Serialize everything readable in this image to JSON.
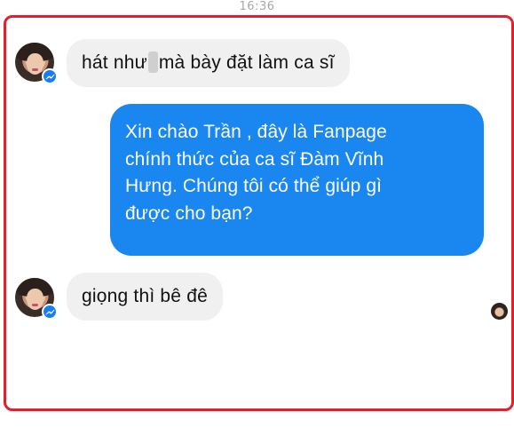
{
  "status_bar": {
    "time": "16:36"
  },
  "thread": {
    "messages": [
      {
        "from": "other",
        "text_before_blur": "hát như",
        "text_after_blur": "mà bày đặt làm ca sĩ"
      },
      {
        "from": "page",
        "lines": [
          "Xin chào Trần , đây là Fanpage",
          "chính thức của ca sĩ Đàm Vĩnh",
          "Hưng. Chúng tôi có thể giúp gì",
          "được cho bạn?"
        ]
      },
      {
        "from": "other",
        "text": "giọng thì bê đê"
      }
    ]
  },
  "colors": {
    "frame_border": "#e41f2d",
    "incoming_bubble": "#f0f0f0",
    "outgoing_bubble": "#1a86f0",
    "messenger_badge": "#1a7cf4"
  },
  "icons": [
    "avatar",
    "messenger-badge-icon",
    "seen-receipt-avatar"
  ]
}
